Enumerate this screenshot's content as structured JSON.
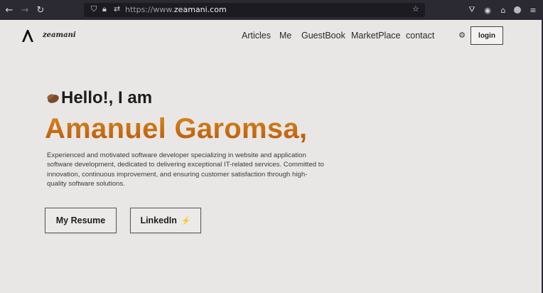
{
  "browser": {
    "url_prefix": "https://www.",
    "url_domain": "zeamani.com",
    "nav_icons": [
      "back-arrow-icon",
      "forward-arrow-icon",
      "reload-icon"
    ],
    "toolbar_icons": [
      "pocket-icon",
      "account-icon",
      "extensions-icon",
      "profile-icon",
      "menu-icon"
    ]
  },
  "site": {
    "logo_text": "zeamani",
    "nav": [
      "Articles",
      "Me",
      "GuestBook",
      "MarketPlace",
      "contact"
    ],
    "login_label": "login"
  },
  "hero": {
    "greeting": "Hello!, I am",
    "name": "Amanuel Garomsa,",
    "bio": "Experienced and motivated software developer specializing in website and application software development, dedicated to delivering exceptional IT-related services. Committed to innovation, continuous improvement, and ensuring customer satisfaction through high-quality software solutions.",
    "resume_label": "My Resume",
    "linkedin_label": "LinkedIn",
    "linkedin_glyph": "⚡"
  },
  "colors": {
    "accent": "#c66a10",
    "background": "#e8e7e6",
    "chrome": "#2b2a33"
  }
}
